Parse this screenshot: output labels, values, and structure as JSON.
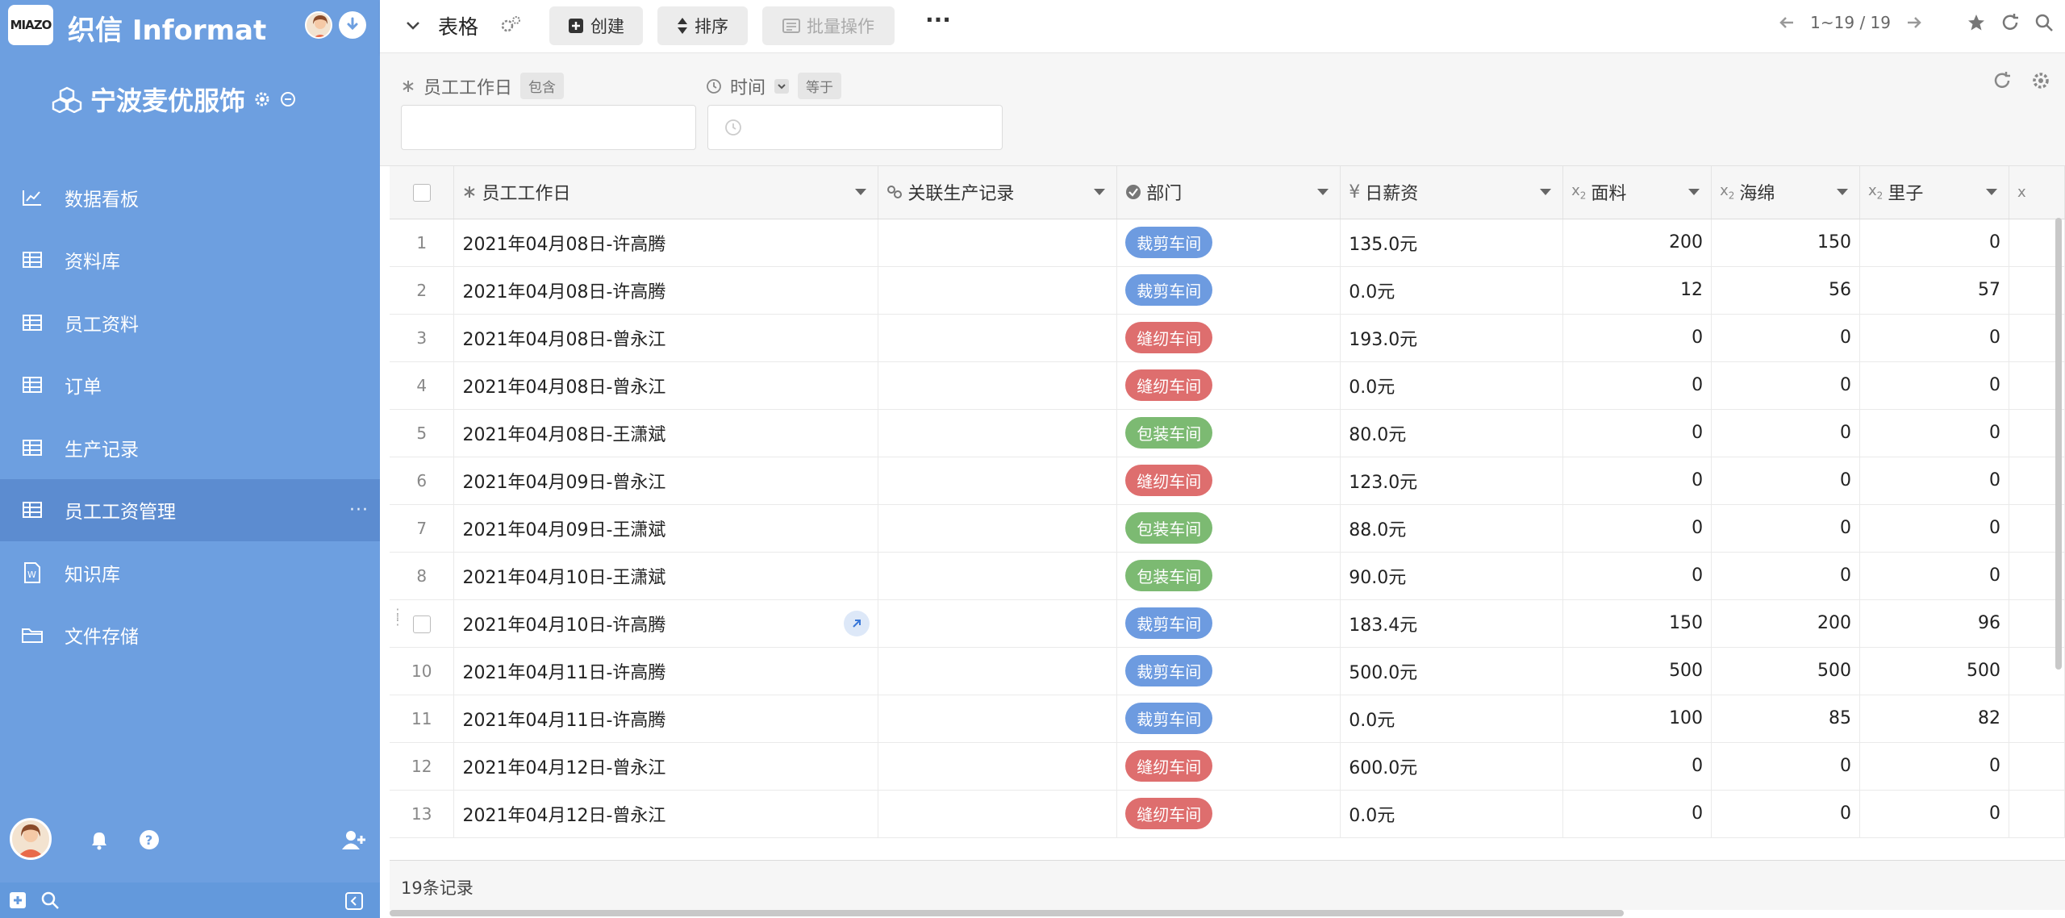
{
  "app": {
    "logo_text": "MIAZO",
    "name": "织信 Informat"
  },
  "workspace": {
    "name": "宁波麦优服饰"
  },
  "sidebar": {
    "items": [
      {
        "label": "数据看板",
        "icon": "chart-line-icon"
      },
      {
        "label": "资料库",
        "icon": "table-icon"
      },
      {
        "label": "员工资料",
        "icon": "table-icon"
      },
      {
        "label": "订单",
        "icon": "table-icon"
      },
      {
        "label": "生产记录",
        "icon": "table-icon"
      },
      {
        "label": "员工工资管理",
        "icon": "table-icon",
        "active": true
      },
      {
        "label": "知识库",
        "icon": "word-doc-icon"
      },
      {
        "label": "文件存储",
        "icon": "folder-icon"
      }
    ],
    "more": "···"
  },
  "toolbar": {
    "title": "表格",
    "create_label": "创建",
    "sort_label": "排序",
    "batch_label": "批量操作",
    "more_label": "···",
    "pagination": "1~19 / 19"
  },
  "filters": [
    {
      "label": "员工工作日",
      "op": "包含",
      "value": ""
    },
    {
      "label": "时间",
      "op": "等于",
      "value": ""
    }
  ],
  "table": {
    "columns": [
      "员工工作日",
      "关联生产记录",
      "部门",
      "日薪资",
      "面料",
      "海绵",
      "里子"
    ],
    "rows": [
      {
        "n": "1",
        "day": "2021年04月08日-许高腾",
        "dept": "裁剪车间",
        "color": "blue",
        "pay": "135.0元",
        "fabric": "200",
        "sponge": "150",
        "lining": "0"
      },
      {
        "n": "2",
        "day": "2021年04月08日-许高腾",
        "dept": "裁剪车间",
        "color": "blue",
        "pay": "0.0元",
        "fabric": "12",
        "sponge": "56",
        "lining": "57"
      },
      {
        "n": "3",
        "day": "2021年04月08日-曾永江",
        "dept": "缝纫车间",
        "color": "red",
        "pay": "193.0元",
        "fabric": "0",
        "sponge": "0",
        "lining": "0"
      },
      {
        "n": "4",
        "day": "2021年04月08日-曾永江",
        "dept": "缝纫车间",
        "color": "red",
        "pay": "0.0元",
        "fabric": "0",
        "sponge": "0",
        "lining": "0"
      },
      {
        "n": "5",
        "day": "2021年04月08日-王潇斌",
        "dept": "包装车间",
        "color": "green",
        "pay": "80.0元",
        "fabric": "0",
        "sponge": "0",
        "lining": "0"
      },
      {
        "n": "6",
        "day": "2021年04月09日-曾永江",
        "dept": "缝纫车间",
        "color": "red",
        "pay": "123.0元",
        "fabric": "0",
        "sponge": "0",
        "lining": "0"
      },
      {
        "n": "7",
        "day": "2021年04月09日-王潇斌",
        "dept": "包装车间",
        "color": "green",
        "pay": "88.0元",
        "fabric": "0",
        "sponge": "0",
        "lining": "0"
      },
      {
        "n": "8",
        "day": "2021年04月10日-王潇斌",
        "dept": "包装车间",
        "color": "green",
        "pay": "90.0元",
        "fabric": "0",
        "sponge": "0",
        "lining": "0"
      },
      {
        "n": "",
        "day": "2021年04月10日-许高腾",
        "dept": "裁剪车间",
        "color": "blue",
        "pay": "183.4元",
        "fabric": "150",
        "sponge": "200",
        "lining": "96"
      },
      {
        "n": "10",
        "day": "2021年04月11日-许高腾",
        "dept": "裁剪车间",
        "color": "blue",
        "pay": "500.0元",
        "fabric": "500",
        "sponge": "500",
        "lining": "500"
      },
      {
        "n": "11",
        "day": "2021年04月11日-许高腾",
        "dept": "裁剪车间",
        "color": "blue",
        "pay": "0.0元",
        "fabric": "100",
        "sponge": "85",
        "lining": "82"
      },
      {
        "n": "12",
        "day": "2021年04月12日-曾永江",
        "dept": "缝纫车间",
        "color": "red",
        "pay": "600.0元",
        "fabric": "0",
        "sponge": "0",
        "lining": "0"
      },
      {
        "n": "13",
        "day": "2021年04月12日-曾永江",
        "dept": "缝纫车间",
        "color": "red",
        "pay": "0.0元",
        "fabric": "0",
        "sponge": "0",
        "lining": "0"
      }
    ],
    "footer": "19条记录"
  },
  "colors": {
    "sidebar": "#6d9fe0",
    "sidebar_active": "#5c8cd0",
    "tag_blue": "#6d9be0",
    "tag_red": "#de6e6e",
    "tag_green": "#7cba72"
  }
}
